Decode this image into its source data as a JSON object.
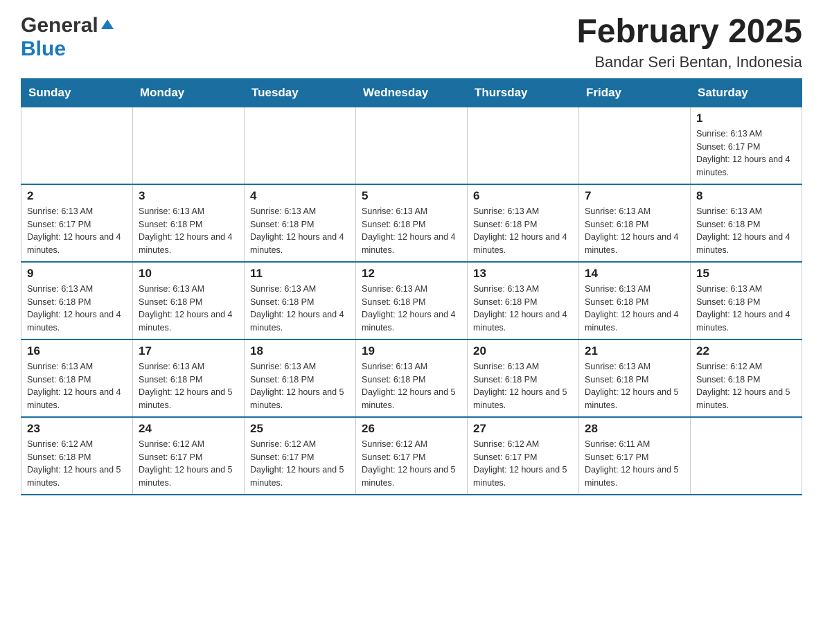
{
  "header": {
    "logo_general": "General",
    "logo_blue": "Blue",
    "title": "February 2025",
    "subtitle": "Bandar Seri Bentan, Indonesia"
  },
  "days_of_week": [
    "Sunday",
    "Monday",
    "Tuesday",
    "Wednesday",
    "Thursday",
    "Friday",
    "Saturday"
  ],
  "weeks": [
    [
      {
        "day": "",
        "info": ""
      },
      {
        "day": "",
        "info": ""
      },
      {
        "day": "",
        "info": ""
      },
      {
        "day": "",
        "info": ""
      },
      {
        "day": "",
        "info": ""
      },
      {
        "day": "",
        "info": ""
      },
      {
        "day": "1",
        "info": "Sunrise: 6:13 AM\nSunset: 6:17 PM\nDaylight: 12 hours and 4 minutes."
      }
    ],
    [
      {
        "day": "2",
        "info": "Sunrise: 6:13 AM\nSunset: 6:17 PM\nDaylight: 12 hours and 4 minutes."
      },
      {
        "day": "3",
        "info": "Sunrise: 6:13 AM\nSunset: 6:18 PM\nDaylight: 12 hours and 4 minutes."
      },
      {
        "day": "4",
        "info": "Sunrise: 6:13 AM\nSunset: 6:18 PM\nDaylight: 12 hours and 4 minutes."
      },
      {
        "day": "5",
        "info": "Sunrise: 6:13 AM\nSunset: 6:18 PM\nDaylight: 12 hours and 4 minutes."
      },
      {
        "day": "6",
        "info": "Sunrise: 6:13 AM\nSunset: 6:18 PM\nDaylight: 12 hours and 4 minutes."
      },
      {
        "day": "7",
        "info": "Sunrise: 6:13 AM\nSunset: 6:18 PM\nDaylight: 12 hours and 4 minutes."
      },
      {
        "day": "8",
        "info": "Sunrise: 6:13 AM\nSunset: 6:18 PM\nDaylight: 12 hours and 4 minutes."
      }
    ],
    [
      {
        "day": "9",
        "info": "Sunrise: 6:13 AM\nSunset: 6:18 PM\nDaylight: 12 hours and 4 minutes."
      },
      {
        "day": "10",
        "info": "Sunrise: 6:13 AM\nSunset: 6:18 PM\nDaylight: 12 hours and 4 minutes."
      },
      {
        "day": "11",
        "info": "Sunrise: 6:13 AM\nSunset: 6:18 PM\nDaylight: 12 hours and 4 minutes."
      },
      {
        "day": "12",
        "info": "Sunrise: 6:13 AM\nSunset: 6:18 PM\nDaylight: 12 hours and 4 minutes."
      },
      {
        "day": "13",
        "info": "Sunrise: 6:13 AM\nSunset: 6:18 PM\nDaylight: 12 hours and 4 minutes."
      },
      {
        "day": "14",
        "info": "Sunrise: 6:13 AM\nSunset: 6:18 PM\nDaylight: 12 hours and 4 minutes."
      },
      {
        "day": "15",
        "info": "Sunrise: 6:13 AM\nSunset: 6:18 PM\nDaylight: 12 hours and 4 minutes."
      }
    ],
    [
      {
        "day": "16",
        "info": "Sunrise: 6:13 AM\nSunset: 6:18 PM\nDaylight: 12 hours and 4 minutes."
      },
      {
        "day": "17",
        "info": "Sunrise: 6:13 AM\nSunset: 6:18 PM\nDaylight: 12 hours and 5 minutes."
      },
      {
        "day": "18",
        "info": "Sunrise: 6:13 AM\nSunset: 6:18 PM\nDaylight: 12 hours and 5 minutes."
      },
      {
        "day": "19",
        "info": "Sunrise: 6:13 AM\nSunset: 6:18 PM\nDaylight: 12 hours and 5 minutes."
      },
      {
        "day": "20",
        "info": "Sunrise: 6:13 AM\nSunset: 6:18 PM\nDaylight: 12 hours and 5 minutes."
      },
      {
        "day": "21",
        "info": "Sunrise: 6:13 AM\nSunset: 6:18 PM\nDaylight: 12 hours and 5 minutes."
      },
      {
        "day": "22",
        "info": "Sunrise: 6:12 AM\nSunset: 6:18 PM\nDaylight: 12 hours and 5 minutes."
      }
    ],
    [
      {
        "day": "23",
        "info": "Sunrise: 6:12 AM\nSunset: 6:18 PM\nDaylight: 12 hours and 5 minutes."
      },
      {
        "day": "24",
        "info": "Sunrise: 6:12 AM\nSunset: 6:17 PM\nDaylight: 12 hours and 5 minutes."
      },
      {
        "day": "25",
        "info": "Sunrise: 6:12 AM\nSunset: 6:17 PM\nDaylight: 12 hours and 5 minutes."
      },
      {
        "day": "26",
        "info": "Sunrise: 6:12 AM\nSunset: 6:17 PM\nDaylight: 12 hours and 5 minutes."
      },
      {
        "day": "27",
        "info": "Sunrise: 6:12 AM\nSunset: 6:17 PM\nDaylight: 12 hours and 5 minutes."
      },
      {
        "day": "28",
        "info": "Sunrise: 6:11 AM\nSunset: 6:17 PM\nDaylight: 12 hours and 5 minutes."
      },
      {
        "day": "",
        "info": ""
      }
    ]
  ]
}
